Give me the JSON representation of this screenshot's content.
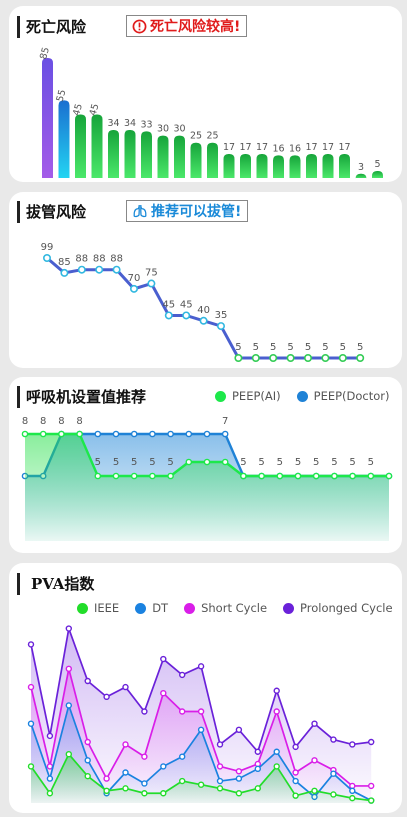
{
  "colors": {
    "death_bar_top": "#7b4fe6",
    "death_bar_mid": "#1fa1e8",
    "death_bar_green": "#1dbb3e",
    "warning_red": "#e01b1b",
    "advice_blue": "#1a8ad8",
    "line_blue": "#4a5fcf",
    "ai_green": "#1de84a",
    "doctor_blue": "#1f82d6",
    "ieee": "#22dd2a",
    "dt": "#1a82e0",
    "short_cycle": "#d91ee8",
    "prolonged_cycle": "#6a21d9"
  },
  "death_risk": {
    "title": "死亡风险",
    "badge": {
      "icon": "alert-circle-icon",
      "text": "死亡风险较高!"
    },
    "chart_data": {
      "type": "bar",
      "values": [
        85,
        55,
        45,
        45,
        34,
        34,
        33,
        30,
        30,
        25,
        25,
        17,
        17,
        17,
        16,
        16,
        17,
        17,
        17,
        3,
        5
      ],
      "labels": [
        "85",
        "55",
        "45",
        "45",
        "34",
        "34",
        "33",
        "30",
        "30",
        "25",
        "25",
        "17",
        "17",
        "17",
        "16",
        "16",
        "17",
        "17",
        "17",
        "3",
        "5"
      ],
      "ylim": [
        0,
        100
      ]
    }
  },
  "extubation_risk": {
    "title": "拔管风险",
    "badge": {
      "icon": "lung-icon",
      "text": "推荐可以拔管!"
    },
    "chart_data": {
      "type": "line",
      "values": [
        99,
        85,
        88,
        88,
        88,
        70,
        75,
        45,
        45,
        40,
        35,
        5,
        5,
        5,
        5,
        5,
        5,
        5,
        5
      ],
      "labels": [
        "99",
        "85",
        "88",
        "88",
        "88",
        "70",
        "75",
        "45",
        "45",
        "40",
        "35",
        "5",
        "5",
        "5",
        "5",
        "5",
        "5",
        "5",
        "5"
      ],
      "ylim": [
        0,
        100
      ]
    }
  },
  "ventilator": {
    "title": "呼吸机设置值推荐",
    "legend": [
      {
        "name": "PEEP(AI)",
        "color_key": "ai_green"
      },
      {
        "name": "PEEP(Doctor)",
        "color_key": "doctor_blue"
      }
    ],
    "chart_data": {
      "type": "area",
      "ylim": [
        0,
        10
      ],
      "series": [
        {
          "name": "PEEP(AI)",
          "values": [
            8,
            8,
            8,
            8,
            5,
            5,
            5,
            5,
            5,
            6,
            6,
            6,
            5,
            5,
            5,
            5,
            5,
            5,
            5,
            5,
            5
          ]
        },
        {
          "name": "PEEP(Doctor)",
          "values": [
            5,
            5,
            8,
            8,
            8,
            8,
            8,
            8,
            8,
            8,
            8,
            8,
            5,
            5,
            5,
            5,
            5,
            5,
            5,
            5,
            5
          ]
        }
      ],
      "labels": [
        {
          "i": 0,
          "text": "8",
          "row": "top"
        },
        {
          "i": 1,
          "text": "8",
          "row": "top"
        },
        {
          "i": 2,
          "text": "8",
          "row": "top"
        },
        {
          "i": 3,
          "text": "8",
          "row": "top"
        },
        {
          "i": 4,
          "text": "5",
          "row": "mid"
        },
        {
          "i": 5,
          "text": "5",
          "row": "mid"
        },
        {
          "i": 6,
          "text": "5",
          "row": "mid"
        },
        {
          "i": 7,
          "text": "5",
          "row": "mid"
        },
        {
          "i": 8,
          "text": "5",
          "row": "mid"
        },
        {
          "i": 11,
          "text": "7",
          "row": "top"
        },
        {
          "i": 12,
          "text": "5",
          "row": "mid"
        },
        {
          "i": 13,
          "text": "5",
          "row": "mid"
        },
        {
          "i": 14,
          "text": "5",
          "row": "mid"
        },
        {
          "i": 15,
          "text": "5",
          "row": "mid"
        },
        {
          "i": 16,
          "text": "5",
          "row": "mid"
        },
        {
          "i": 17,
          "text": "5",
          "row": "mid"
        },
        {
          "i": 18,
          "text": "5",
          "row": "mid"
        },
        {
          "i": 19,
          "text": "5",
          "row": "mid"
        }
      ]
    }
  },
  "pva": {
    "title": "PVA指数",
    "legend": [
      {
        "name": "IEEE",
        "color_key": "ieee"
      },
      {
        "name": "DT",
        "color_key": "dt"
      },
      {
        "name": "Short Cycle",
        "color_key": "short_cycle"
      },
      {
        "name": "Prolonged Cycle",
        "color_key": "prolonged_cycle"
      }
    ],
    "chart_data": {
      "type": "area",
      "ylim": [
        0,
        100
      ],
      "series": [
        {
          "name": "IEEE",
          "values": [
            30,
            8,
            40,
            22,
            10,
            12,
            8,
            8,
            18,
            15,
            12,
            8,
            12,
            30,
            6,
            10,
            7,
            4,
            2
          ]
        },
        {
          "name": "DT",
          "values": [
            65,
            20,
            80,
            35,
            8,
            25,
            16,
            30,
            38,
            60,
            18,
            20,
            28,
            42,
            18,
            5,
            24,
            10,
            2
          ]
        },
        {
          "name": "Short Cycle",
          "values": [
            95,
            30,
            110,
            50,
            20,
            48,
            38,
            90,
            75,
            75,
            30,
            26,
            32,
            75,
            25,
            35,
            27,
            14,
            14
          ]
        },
        {
          "name": "Prolonged Cycle",
          "values": [
            130,
            55,
            143,
            100,
            87,
            95,
            75,
            118,
            105,
            112,
            48,
            60,
            42,
            92,
            46,
            65,
            52,
            48,
            50
          ]
        }
      ]
    }
  }
}
